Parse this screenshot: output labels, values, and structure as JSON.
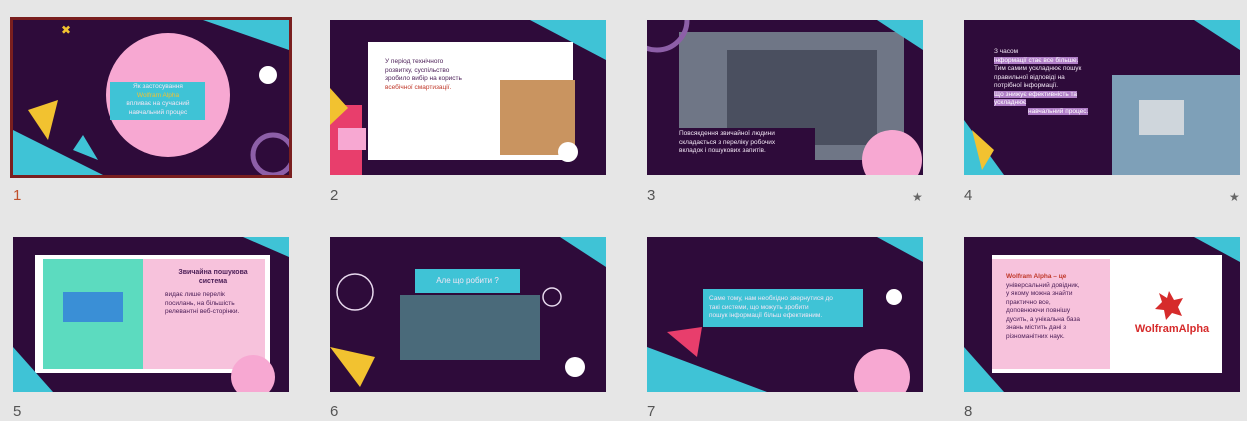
{
  "slides": [
    {
      "number": "1",
      "selected": true,
      "title_lines": [
        "Як застосування",
        "Wolfram Alpha",
        "впливає на сучасний",
        "навчальний процес"
      ]
    },
    {
      "number": "2",
      "text_lines": [
        "У період технічного",
        "розвитку, суспільство",
        "зробило вибір на користь",
        "всебічної смартизації."
      ]
    },
    {
      "number": "3",
      "starred": true,
      "text_lines": [
        "Повсякдення звичайної людини",
        "складається з переліку робочих",
        "вкладок і пошукових запитів."
      ]
    },
    {
      "number": "4",
      "starred": true,
      "text_lines": [
        "З часом",
        "інформації стає все більше.",
        "Тим самим ускладнює пошук",
        "правильної відповіді на",
        "потрібної інформації.",
        "Що знижує ефективність та",
        "ускладнює",
        "навчальний процес."
      ]
    },
    {
      "number": "5",
      "title_lines": [
        "Звичайна пошукова",
        "система"
      ],
      "text_lines": [
        "видає лише перелік",
        "посилань, на більшість",
        "релевантні веб-сторінки."
      ]
    },
    {
      "number": "6",
      "title": "Але що робити ?"
    },
    {
      "number": "7",
      "text_lines": [
        "Саме тому, нам необхідно звернутися до",
        "такі системи, що можуть зробити",
        "пошук інформації більш ефективним."
      ]
    },
    {
      "number": "8",
      "brand": "WolframAlpha",
      "text_lines": [
        "Wolfram Alpha – це",
        "універсальний довідник,",
        "у якому можна знайти",
        "практично все,",
        "доповнюючи повнішу",
        "дусить, а унікальна база",
        "знань містить дані з",
        "різноманітних наук."
      ]
    }
  ],
  "star_icon": "★",
  "colors": {
    "bg": "#2e0b3a",
    "cyan": "#3fc3d6",
    "pink": "#f7a8d2",
    "yellow": "#f2c230",
    "selection": "#7a1f1f"
  }
}
